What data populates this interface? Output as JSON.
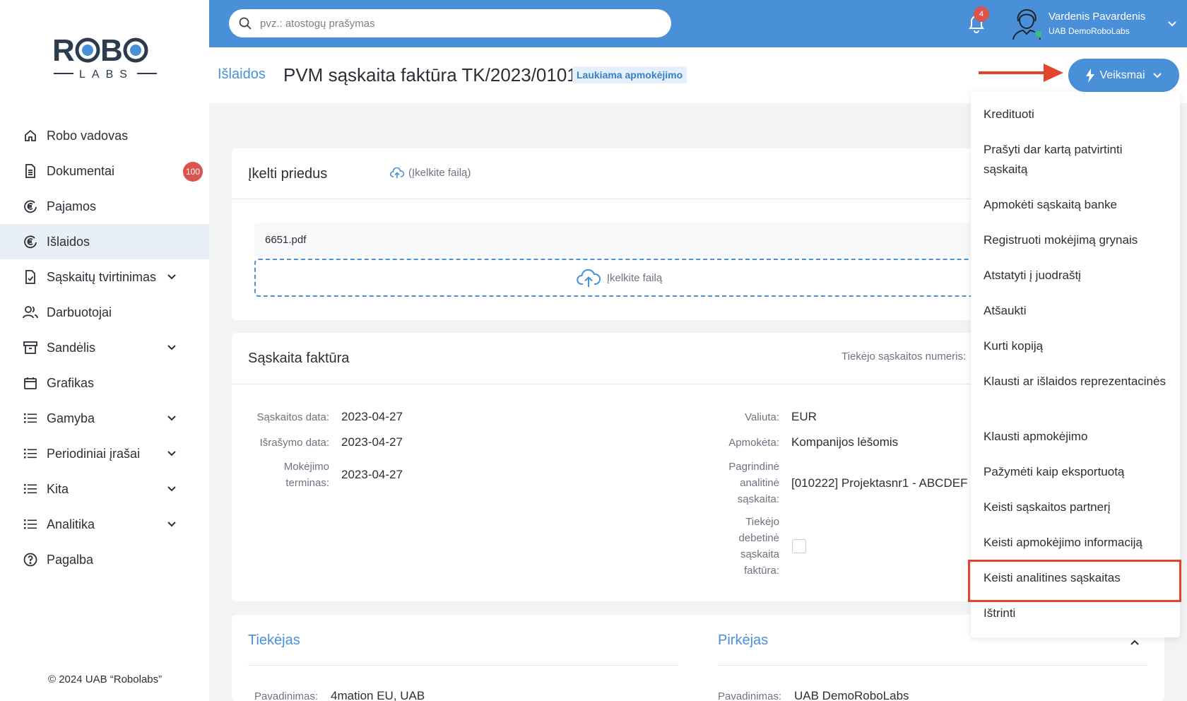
{
  "brand": {
    "logo_top": "ROBO",
    "logo_bottom": "LABS"
  },
  "sidebar": {
    "items": [
      {
        "label": "Robo vadovas",
        "icon": "home-icon"
      },
      {
        "label": "Dokumentai",
        "icon": "document-icon",
        "badge": "100"
      },
      {
        "label": "Pajamos",
        "icon": "euro-in-icon"
      },
      {
        "label": "Išlaidos",
        "icon": "euro-out-icon",
        "active": true
      },
      {
        "label": "Sąskaitų tvirtinimas",
        "icon": "file-check-icon",
        "expandable": true
      },
      {
        "label": "Darbuotojai",
        "icon": "users-icon"
      },
      {
        "label": "Sandėlis",
        "icon": "archive-icon",
        "expandable": true
      },
      {
        "label": "Grafikas",
        "icon": "calendar-icon"
      },
      {
        "label": "Gamyba",
        "icon": "list-icon",
        "expandable": true
      },
      {
        "label": "Periodiniai įrašai",
        "icon": "list-icon",
        "expandable": true
      },
      {
        "label": "Kita",
        "icon": "list-icon",
        "expandable": true
      },
      {
        "label": "Analitika",
        "icon": "list-icon",
        "expandable": true
      },
      {
        "label": "Pagalba",
        "icon": "help-icon"
      }
    ],
    "copyright": "© 2024 UAB “Robolabs”"
  },
  "topbar": {
    "search_placeholder": "pvz.: atostogų prašymas",
    "notifications_count": "4",
    "user_name": "Vardenis Pavardenis",
    "user_company": "UAB DemoRoboLabs"
  },
  "header": {
    "breadcrumb": "Išlaidos",
    "title": "PVM sąskaita faktūra TK/2023/0101",
    "status": "Laukiama apmokėjimo",
    "actions_button": "Veiksmai"
  },
  "attachments": {
    "title": "Įkelti priedus",
    "upload_link": "(Įkelkite failą)",
    "file_name": "6651.pdf",
    "dropzone_text": "Įkelkite failą"
  },
  "invoice": {
    "title": "Sąskaita faktūra",
    "supplier_number_label": "Tiekėjo sąskaitos numeris:",
    "left_fields": [
      {
        "label": "Sąskaitos data:",
        "value": "2023-04-27"
      },
      {
        "label": "Išrašymo data:",
        "value": "2023-04-27"
      },
      {
        "label": "Mokėjimo terminas:",
        "value": "2023-04-27"
      }
    ],
    "right_fields": [
      {
        "label": "Valiuta:",
        "value": "EUR"
      },
      {
        "label": "Apmokėta:",
        "value": "Kompanijos lėšomis"
      },
      {
        "label": "Pagrindinė analitinė sąskaita:",
        "value": "[010222] Projektasnr1 - ABCDEFG"
      },
      {
        "label": "Tiekėjo debetinė sąskaita faktūra:",
        "value": ""
      }
    ]
  },
  "parties": {
    "supplier_title": "Tiekėjas",
    "buyer_title": "Pirkėjas",
    "name_label": "Pavadinimas:",
    "supplier_name": "4mation EU, UAB",
    "buyer_name": "UAB DemoRoboLabs"
  },
  "actions_menu": {
    "items": [
      "Kredituoti",
      "Prašyti dar kartą patvirtinti sąskaitą",
      "Apmokėti sąskaitą banke",
      "Registruoti mokėjimą grynais",
      "Atstatyti į juodraštį",
      "Atšaukti",
      "Kurti kopiją",
      "Klausti ar išlaidos reprezentacinės",
      "Klausti apmokėjimo",
      "Pažymėti kaip eksportuotą",
      "Keisti sąskaitos partnerį",
      "Keisti apmokėjimo informaciją",
      "Keisti analitines sąskaitas",
      "Ištrinti"
    ],
    "highlighted_item": "Keisti analitines sąskaitas"
  },
  "colors": {
    "primary": "#4a90d9",
    "badge_red": "#d9534f",
    "highlight_red": "#e2452e",
    "active_nav_bg": "#e8eff7"
  }
}
